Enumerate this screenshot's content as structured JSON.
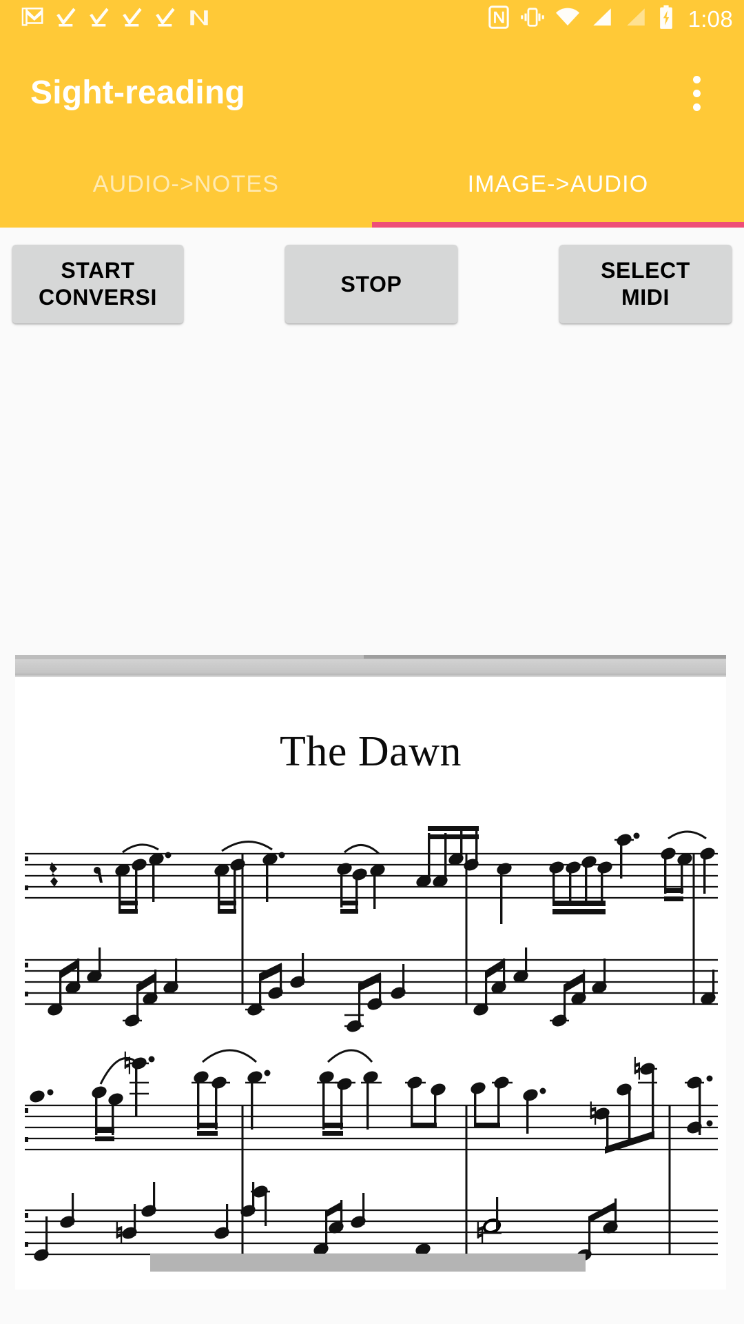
{
  "status_bar": {
    "background_color": "#FFC937",
    "time": "1:08",
    "left_icons": [
      {
        "name": "gmail-icon",
        "label": "Gmail"
      },
      {
        "name": "task-complete-icon-1",
        "label": "Task complete"
      },
      {
        "name": "task-complete-icon-2",
        "label": "Task complete"
      },
      {
        "name": "task-complete-icon-3",
        "label": "Task complete"
      },
      {
        "name": "task-complete-icon-4",
        "label": "Task complete"
      },
      {
        "name": "nova-launcher-icon",
        "label": "N"
      }
    ],
    "right_icons": [
      {
        "name": "nfc-icon",
        "label": "NFC"
      },
      {
        "name": "vibrate-icon",
        "label": "Vibrate"
      },
      {
        "name": "wifi-icon",
        "label": "Wi-Fi"
      },
      {
        "name": "cellular-signal-icon",
        "label": "Signal"
      },
      {
        "name": "cellular-signal-empty-icon",
        "label": "No signal"
      },
      {
        "name": "battery-charging-icon",
        "label": "Battery charging"
      }
    ]
  },
  "app_bar": {
    "title": "Sight-reading",
    "background_color": "#FFC937",
    "title_color": "#FFFFFF",
    "overflow_menu_label": "More options"
  },
  "tabs": {
    "indicator_color": "#EE4E77",
    "active_index": 1,
    "items": [
      {
        "label": "AUDIO->NOTES",
        "active": false
      },
      {
        "label": "IMAGE->AUDIO",
        "active": true
      }
    ]
  },
  "toolbar": {
    "background_color": "#FAFAFA",
    "buttons": [
      {
        "name": "start-conversion-button",
        "label": "START\nCONVERSI"
      },
      {
        "name": "stop-button",
        "label": "STOP"
      },
      {
        "name": "select-midi-button",
        "label": "SELECT\nMIDI"
      }
    ],
    "button_color": "#D6D7D7",
    "button_text_color": "#000000"
  },
  "score_viewer": {
    "sheet_title": "The Dawn",
    "background_color": "#FFFFFF",
    "scrollbar_color": "#B4B4B4",
    "systems": [
      {
        "name": "system-1",
        "treble_staff": true,
        "bass_staff": true,
        "measures": 4
      },
      {
        "name": "system-2",
        "treble_staff": true,
        "bass_staff": true,
        "measures": 4
      }
    ]
  }
}
